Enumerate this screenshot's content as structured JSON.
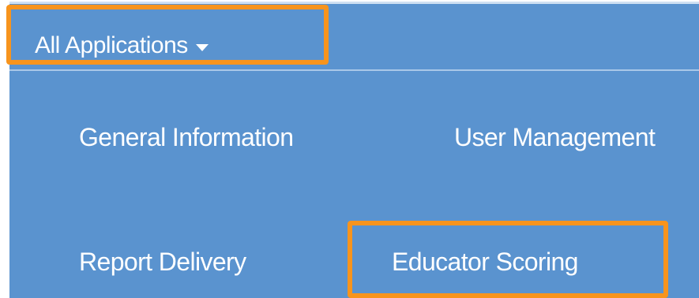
{
  "header": {
    "apps_menu_label": "All Applications",
    "apps_menu_icon": "caret-down-icon"
  },
  "nav": {
    "items": [
      {
        "label": "General Information"
      },
      {
        "label": "User Management"
      },
      {
        "label": "Report Delivery"
      },
      {
        "label": "Educator Scoring"
      }
    ]
  },
  "colors": {
    "background": "#5a93cf",
    "text": "#ffffff",
    "highlight": "#f7941d"
  }
}
